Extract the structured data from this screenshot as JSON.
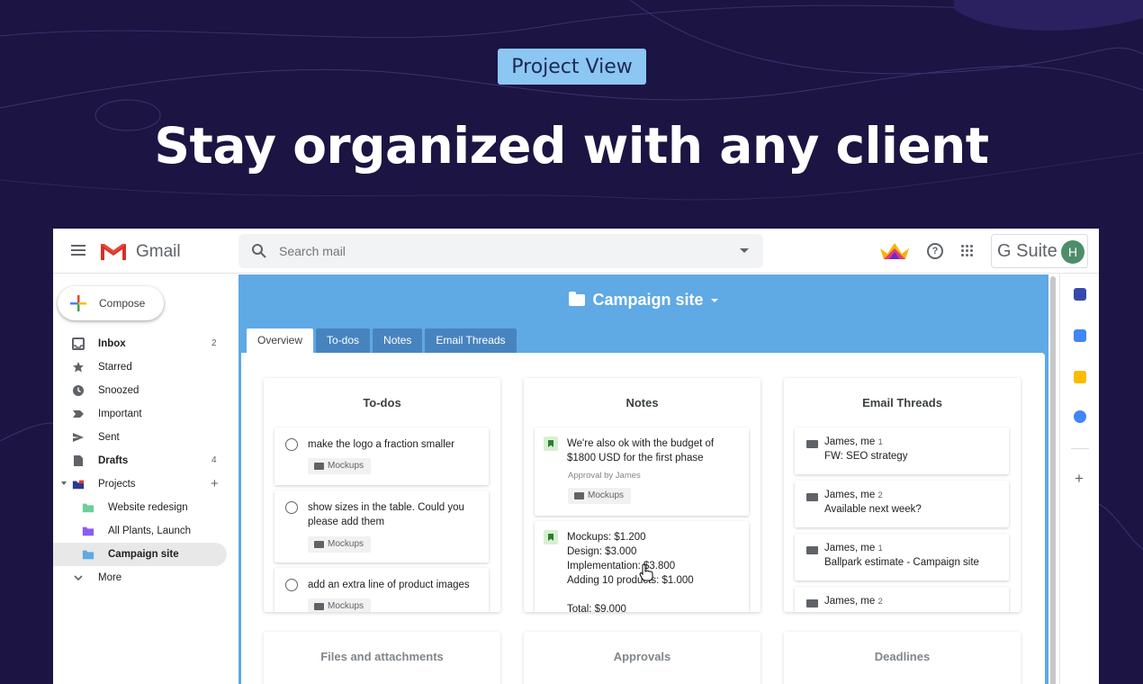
{
  "badge": "Project View",
  "hero_title": "Stay organized with any client",
  "gmail": {
    "logo_text": "Gmail",
    "search_placeholder": "Search mail",
    "gsuite_label": "G Suite",
    "avatar_letter": "H"
  },
  "sidebar": {
    "compose_label": "Compose",
    "items": [
      {
        "label": "Inbox",
        "count": "2",
        "icon": "inbox-icon",
        "bold": true
      },
      {
        "label": "Starred",
        "count": "",
        "icon": "star-icon"
      },
      {
        "label": "Snoozed",
        "count": "",
        "icon": "clock-icon"
      },
      {
        "label": "Important",
        "count": "",
        "icon": "important-icon"
      },
      {
        "label": "Sent",
        "count": "",
        "icon": "send-icon"
      },
      {
        "label": "Drafts",
        "count": "4",
        "icon": "draft-icon",
        "bold": true
      },
      {
        "label": "Projects",
        "count": "",
        "icon": "projects-folder-icon"
      }
    ],
    "projects": [
      {
        "label": "Website redesign",
        "color": "#6fcf97"
      },
      {
        "label": "All Plants, Launch",
        "color": "#8b5cf6"
      },
      {
        "label": "Campaign site",
        "color": "#5fa9e4",
        "active": true
      }
    ],
    "more_label": "More"
  },
  "project": {
    "title": "Campaign site",
    "tabs": [
      "Overview",
      "To-dos",
      "Notes",
      "Email Threads"
    ],
    "todos": {
      "title": "To-dos",
      "items": [
        {
          "text": "make the logo a fraction smaller",
          "tag": "Mockups"
        },
        {
          "text": "show sizes in the table. Could you please add them",
          "tag": "Mockups"
        },
        {
          "text": "add an extra line of product images",
          "tag": "Mockups"
        }
      ]
    },
    "notes": {
      "title": "Notes",
      "items": [
        {
          "line1": "We're also ok with the budget of",
          "line2": "$1800 USD for the first phase",
          "sub": "Approval by James",
          "tag": "Mockups"
        },
        {
          "line1": "Mockups: $1.200",
          "line2": "Design: $3.000",
          "line3": "Implementation: $3.800",
          "line4": "Adding 10 products: $1.000",
          "line5": "Total: $9.000"
        }
      ]
    },
    "threads": {
      "title": "Email Threads",
      "items": [
        {
          "from": "James, me",
          "count": "1",
          "subject": "FW: SEO strategy"
        },
        {
          "from": "James, me",
          "count": "2",
          "subject": "Available next week?"
        },
        {
          "from": "James, me",
          "count": "1",
          "subject": "Ballpark estimate - Campaign site"
        },
        {
          "from": "James, me",
          "count": "2",
          "subject": ""
        }
      ]
    },
    "bottom_cards": [
      "Files and attachments",
      "Approvals",
      "Deadlines"
    ]
  },
  "colors": {
    "background": "#1c1442",
    "badge": "#8cc6f2",
    "project_header": "#5fa9e4",
    "tab_inactive": "#4784bf"
  }
}
